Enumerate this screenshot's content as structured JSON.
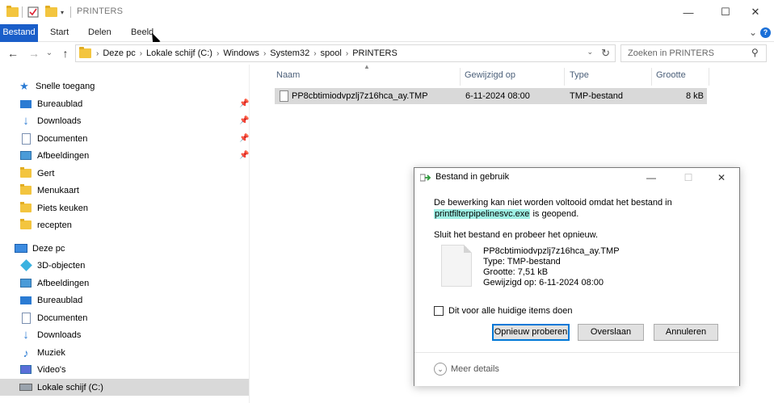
{
  "window": {
    "title": "PRINTERS",
    "minimize": "—",
    "maximize": "☐",
    "close": "✕"
  },
  "ribbon": {
    "tabs": [
      "Bestand",
      "Start",
      "Delen",
      "Beeld"
    ],
    "expand": "⌄",
    "help": "?"
  },
  "nav": {
    "back": "←",
    "forward": "→",
    "recent": "⌄",
    "up": "↑",
    "breadcrumbs": [
      "Deze pc",
      "Lokale schijf (C:)",
      "Windows",
      "System32",
      "spool",
      "PRINTERS"
    ],
    "search_placeholder": "Zoeken in PRINTERS"
  },
  "sidebar": {
    "quick_access": "Snelle toegang",
    "quick_items": [
      {
        "label": "Bureaublad",
        "pinned": true
      },
      {
        "label": "Downloads",
        "pinned": true
      },
      {
        "label": "Documenten",
        "pinned": true
      },
      {
        "label": "Afbeeldingen",
        "pinned": true
      },
      {
        "label": "Gert",
        "pinned": false
      },
      {
        "label": "Menukaart",
        "pinned": false
      },
      {
        "label": "Piets keuken",
        "pinned": false
      },
      {
        "label": "recepten",
        "pinned": false
      }
    ],
    "this_pc": "Deze pc",
    "pc_items": [
      "3D-objecten",
      "Afbeeldingen",
      "Bureaublad",
      "Documenten",
      "Downloads",
      "Muziek",
      "Video's",
      "Lokale schijf (C:)"
    ]
  },
  "filelist": {
    "columns": [
      "Naam",
      "Gewijzigd op",
      "Type",
      "Grootte"
    ],
    "rows": [
      {
        "name": "PP8cbtimiodvpzlj7z16hca_ay.TMP",
        "modified": "6-11-2024 08:00",
        "type": "TMP-bestand",
        "size": "8 kB"
      }
    ]
  },
  "dialog": {
    "title": "Bestand in gebruik",
    "message_line1": "De bewerking kan niet worden voltooid omdat het bestand in",
    "highlighted_process": "printfilterpipelinesvc.exe",
    "message_tail": " is geopend.",
    "message2": "Sluit het bestand en probeer het opnieuw.",
    "file_name": "PP8cbtimiodvpzlj7z16hca_ay.TMP",
    "file_type": "Type: TMP-bestand",
    "file_size": "Grootte: 7,51 kB",
    "file_modified": "Gewijzigd op: 6-11-2024 08:00",
    "checkbox_label": "Dit voor alle huidige items doen",
    "buttons": {
      "retry": "Opnieuw proberen",
      "skip": "Overslaan",
      "cancel": "Annuleren"
    },
    "more_details": "Meer details"
  }
}
